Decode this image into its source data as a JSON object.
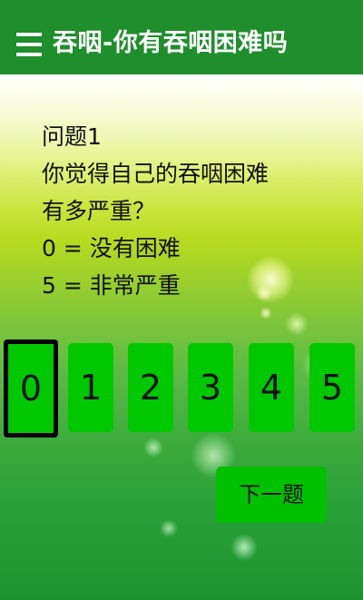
{
  "app_bar": {
    "title": "吞咽-你有吞咽困难吗",
    "menu_icon": "menu-icon",
    "background": "#1f8e2c"
  },
  "question": {
    "number_label": "问题1",
    "text_line1": "你觉得自己的吞咽困难",
    "text_line2": "有多严重？",
    "scale_min_label": "0 = 没有困难",
    "scale_max_label": "5 = 非常严重"
  },
  "scale": {
    "options": [
      "0",
      "1",
      "2",
      "3",
      "4",
      "5"
    ],
    "selected": "0",
    "button_color": "#00c800",
    "selected_border_color": "#000000"
  },
  "navigation": {
    "next_label": "下一题"
  }
}
